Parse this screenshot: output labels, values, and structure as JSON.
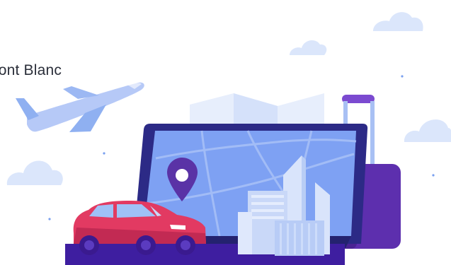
{
  "hero": {
    "visible_text": "Mont Blanc"
  },
  "illustration": {
    "elements": [
      "cloud-icon",
      "airplane-icon",
      "map-icon",
      "laptop-icon",
      "location-pin-icon",
      "car-icon",
      "buildings-icon",
      "suitcase-icon"
    ],
    "colors": {
      "cloud": "#dbe6fb",
      "airplane": "#9fb8f4",
      "map": "#e7eefc",
      "laptop_frame": "#2c2a86",
      "screen": "#7ea1f3",
      "pin": "#5a33a6",
      "car": "#e23a62",
      "suitcase": "#5d2fae",
      "buildings": "#c9d8f8"
    }
  }
}
